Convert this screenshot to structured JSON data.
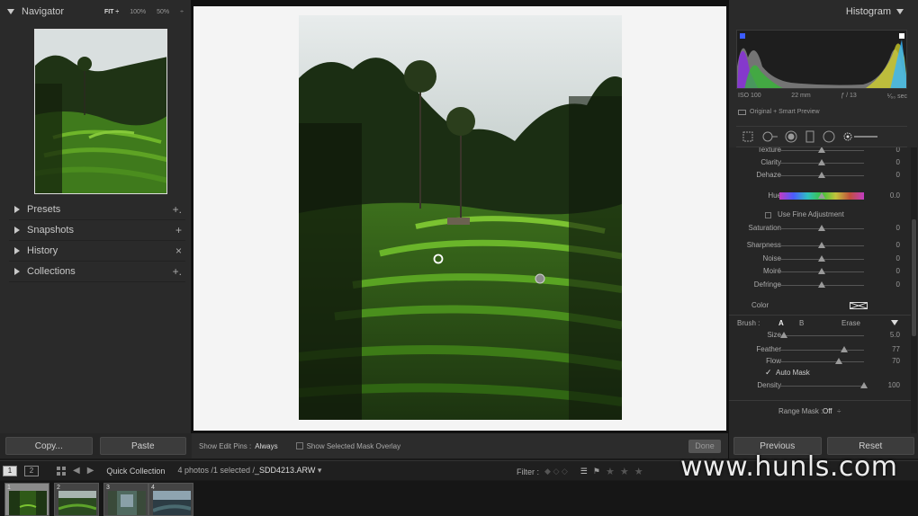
{
  "navigator": {
    "title": "Navigator",
    "zoom_options": [
      "FIT ÷",
      "100%",
      "50%",
      "÷"
    ]
  },
  "left_panels": [
    {
      "label": "Presets",
      "action": "+."
    },
    {
      "label": "Snapshots",
      "action": "+"
    },
    {
      "label": "History",
      "action": "×"
    },
    {
      "label": "Collections",
      "action": "+."
    }
  ],
  "left_buttons": {
    "copy": "Copy...",
    "paste": "Paste"
  },
  "toolbar": {
    "show_edit_pins_label": "Show Edit Pins :",
    "show_edit_pins_value": "Always",
    "mask_overlay_label": "Show Selected Mask Overlay",
    "done_label": "Done"
  },
  "histogram": {
    "title": "Histogram",
    "iso": "ISO 100",
    "focal": "22 mm",
    "aperture": "ƒ / 13",
    "shutter": "⅟₆₀ sec",
    "preview": "Original + Smart Preview"
  },
  "mask_sliders": [
    {
      "label": "Texture",
      "value": "0",
      "pos": 0.5
    },
    {
      "label": "Clarity",
      "value": "0",
      "pos": 0.5
    },
    {
      "label": "Dehaze",
      "value": "0",
      "pos": 0.5
    },
    {
      "label": "Hue",
      "value": "0.0",
      "pos": 0.5
    },
    {
      "label": "Saturation",
      "value": "0",
      "pos": 0.5
    },
    {
      "label": "Sharpness",
      "value": "0",
      "pos": 0.5
    },
    {
      "label": "Noise",
      "value": "0",
      "pos": 0.5
    },
    {
      "label": "Moiré",
      "value": "0",
      "pos": 0.5
    },
    {
      "label": "Defringe",
      "value": "0",
      "pos": 0.5
    }
  ],
  "fine_adjust_label": "Use Fine Adjustment",
  "color_label": "Color",
  "brush": {
    "label": "Brush :",
    "tab_a": "A",
    "tab_b": "B",
    "erase": "Erase",
    "sliders": [
      {
        "label": "Size",
        "value": "5.0",
        "pos": 0.05
      },
      {
        "label": "Feather",
        "value": "77",
        "pos": 0.77
      },
      {
        "label": "Flow",
        "value": "70",
        "pos": 0.7
      }
    ],
    "auto_mask_label": "Auto Mask",
    "density": {
      "label": "Density",
      "value": "100",
      "pos": 1.0
    }
  },
  "range_mask": {
    "label": "Range Mask :",
    "value": "Off"
  },
  "right_buttons": {
    "previous": "Previous",
    "reset": "Reset"
  },
  "filmstrip_bar": {
    "page1": "1",
    "page2": "2",
    "source": "Quick Collection",
    "count": "4 photos /1 selected /",
    "filename": "_SDD4213.ARW",
    "filter_label": "Filter :"
  },
  "filmstrip": [
    {
      "index": "1"
    },
    {
      "index": "2"
    },
    {
      "index": "3"
    },
    {
      "index": "4"
    }
  ],
  "watermark": "www.hunls.com"
}
